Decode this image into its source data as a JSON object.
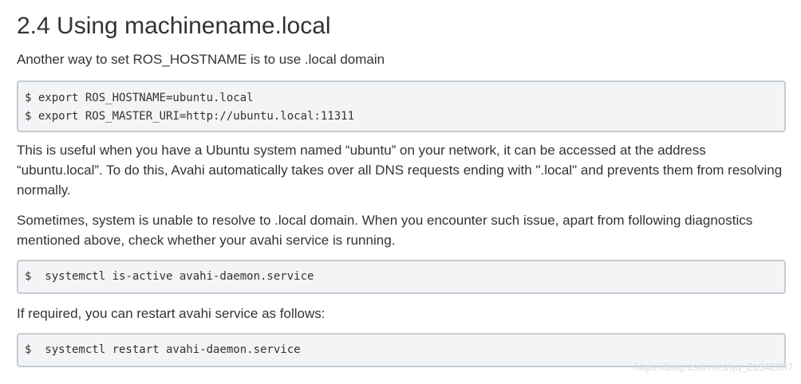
{
  "heading": "2.4 Using machinename.local",
  "intro": "Another way to set ROS_HOSTNAME is to use .local domain",
  "code_block_1": [
    "$ export ROS_HOSTNAME=ubuntu.local",
    "$ export ROS_MASTER_URI=http://ubuntu.local:11311"
  ],
  "paragraph_useful": "This is useful when you have a Ubuntu system named “ubuntu” on your network, it can be accessed at the address “ubuntu.local”. To do this, Avahi automatically takes over all DNS requests ending with \".local\" and prevents them from resolving normally.",
  "paragraph_sometimes": "Sometimes, system is unable to resolve to .local domain. When you encounter such issue, apart from following diagnostics mentioned above, check whether your avahi service is running.",
  "code_block_2": "$  systemctl is-active avahi-daemon.service",
  "paragraph_restart": "If required, you can restart avahi service as follows:",
  "code_block_3": "$  systemctl restart avahi-daemon.service",
  "watermark": "https://blog.csdn.net/qq_21842097"
}
